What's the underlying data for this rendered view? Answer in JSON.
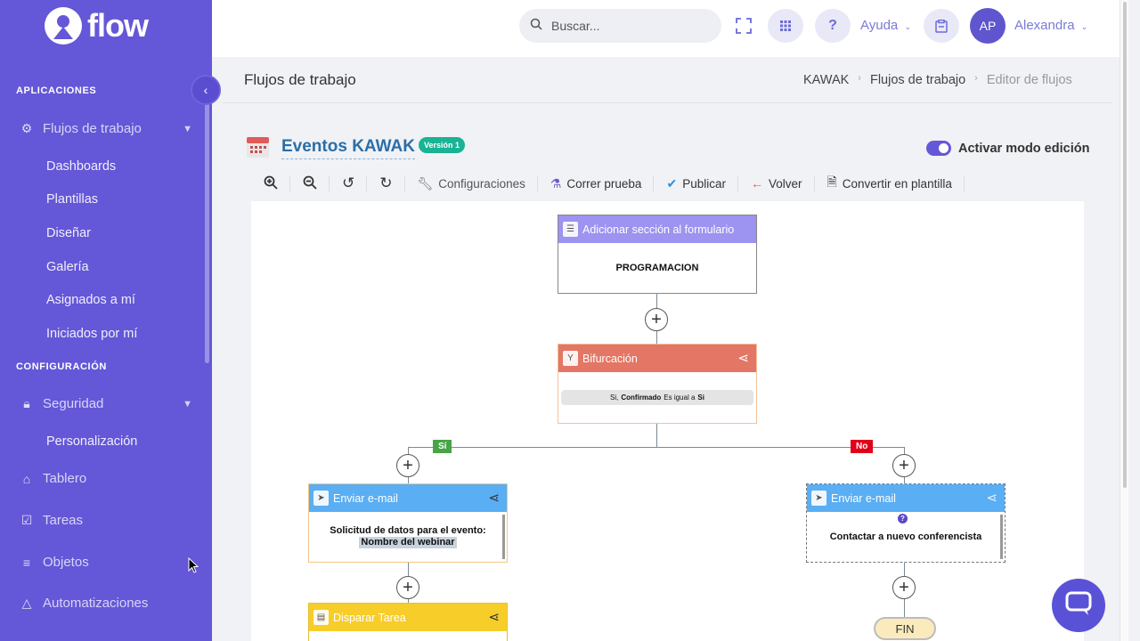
{
  "app": {
    "name": "flow"
  },
  "sidebar": {
    "sections": {
      "apps": "APLICACIONES",
      "config": "CONFIGURACIÓN"
    },
    "flujos": "Flujos de trabajo",
    "flujos_sub": [
      "Dashboards",
      "Plantillas",
      "Diseñar",
      "Galería",
      "Asignados a mí",
      "Iniciados por mí"
    ],
    "seguridad": "Seguridad",
    "seguridad_sub": [
      "Personalización"
    ],
    "items": [
      "Tablero",
      "Tareas",
      "Objetos",
      "Automatizaciones"
    ]
  },
  "topbar": {
    "search_placeholder": "Buscar...",
    "help": "Ayuda",
    "avatar_initials": "AP",
    "user": "Alexandra"
  },
  "page": {
    "title": "Flujos de trabajo",
    "breadcrumb": [
      "KAWAK",
      "Flujos de trabajo",
      "Editor de flujos"
    ]
  },
  "flow": {
    "title": "Eventos KAWAK",
    "version": "Versión 1",
    "edit_mode_label": "Activar modo edición"
  },
  "toolbar": {
    "config": "Configuraciones",
    "test": "Correr prueba",
    "publish": "Publicar",
    "back": "Volver",
    "template": "Convertir en plantilla"
  },
  "nodes": {
    "section": {
      "title": "Adicionar sección al formulario",
      "body": "PROGRAMACION",
      "color": "#9d93f0"
    },
    "fork": {
      "title": "Bifurcación",
      "cond_pre": "Si,",
      "cond_field": "Confirmado",
      "cond_op": "Es igual a",
      "cond_val": "Si",
      "color": "#e37664"
    },
    "email_left": {
      "title": "Enviar e-mail",
      "body_line1": "Solicitud de datos para el evento:",
      "body_line2": "Nombre del webinar",
      "color": "#5aaef3"
    },
    "email_right": {
      "title": "Enviar e-mail",
      "body": "Contactar a nuevo conferencista",
      "badge": "?",
      "color": "#5aaef3"
    },
    "task": {
      "title": "Disparar Tarea",
      "color": "#f7cd2a"
    },
    "branch_yes": "Sí",
    "branch_no": "No",
    "end": "FIN"
  }
}
